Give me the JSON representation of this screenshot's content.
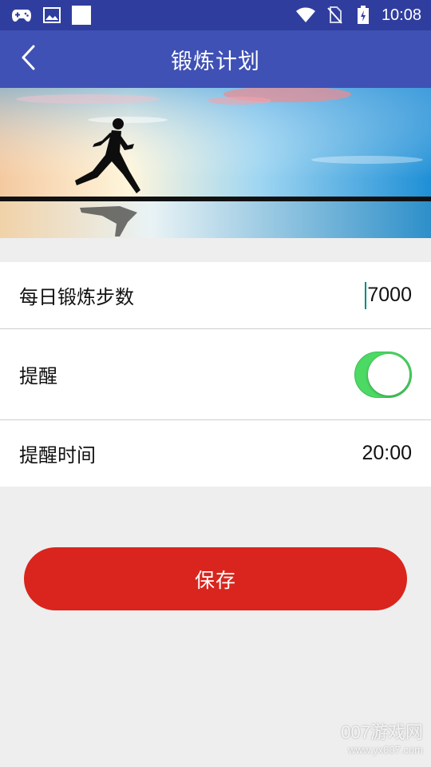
{
  "status_bar": {
    "time": "10:08",
    "left_icons": [
      "gamepad-icon",
      "image-icon",
      "white-square-icon"
    ],
    "right_icons": [
      "wifi-icon",
      "no-sim-icon",
      "battery-charging-icon"
    ]
  },
  "app_bar": {
    "title": "锻炼计划",
    "back_icon": "chevron-left-icon"
  },
  "settings": {
    "steps_label": "每日锻炼步数",
    "steps_value": "7000",
    "remind_label": "提醒",
    "remind_on": true,
    "time_label": "提醒时间",
    "time_value": "20:00"
  },
  "save_button": {
    "label": "保存"
  },
  "watermark": {
    "line1": "007游戏网",
    "line2": "www.yx007.com"
  },
  "colors": {
    "status_bar": "#2f3e9e",
    "app_bar": "#3f51b5",
    "toggle_on": "#4cd964",
    "save_button": "#d9251d",
    "background": "#eeeeee"
  }
}
